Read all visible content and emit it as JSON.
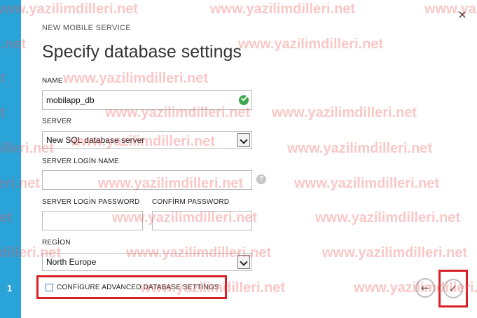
{
  "wizard": {
    "step_number": "1",
    "kicker": "NEW MOBILE SERVICE",
    "title": "Specify database settings",
    "close_glyph": "×"
  },
  "form": {
    "name": {
      "label": "NAME",
      "value": "mobilapp_db",
      "valid": true
    },
    "server": {
      "label": "SERVER",
      "value": "New SQL database server"
    },
    "server_login_name": {
      "label": "SERVER LOGİN NAME",
      "value": "",
      "help_glyph": "?"
    },
    "server_login_password": {
      "label": "SERVER LOGİN PASSWORD",
      "value": ""
    },
    "confirm_password": {
      "label": "CONFİRM PASSWORD",
      "value": ""
    },
    "region": {
      "label": "REGİON",
      "value": "North Europe"
    },
    "advanced": {
      "label": "CONFİGURE ADVANCED DATABASE SETTİNGS",
      "checked": false
    }
  },
  "nav": {
    "back_glyph": "←",
    "next_glyph": "✓"
  },
  "watermark": {
    "text": "www.yazilimdilleri.net"
  },
  "colors": {
    "step_rail": "#2aa3d8",
    "highlight": "#d92027",
    "valid_check": "#3ea64b",
    "watermark": "#f05050"
  }
}
